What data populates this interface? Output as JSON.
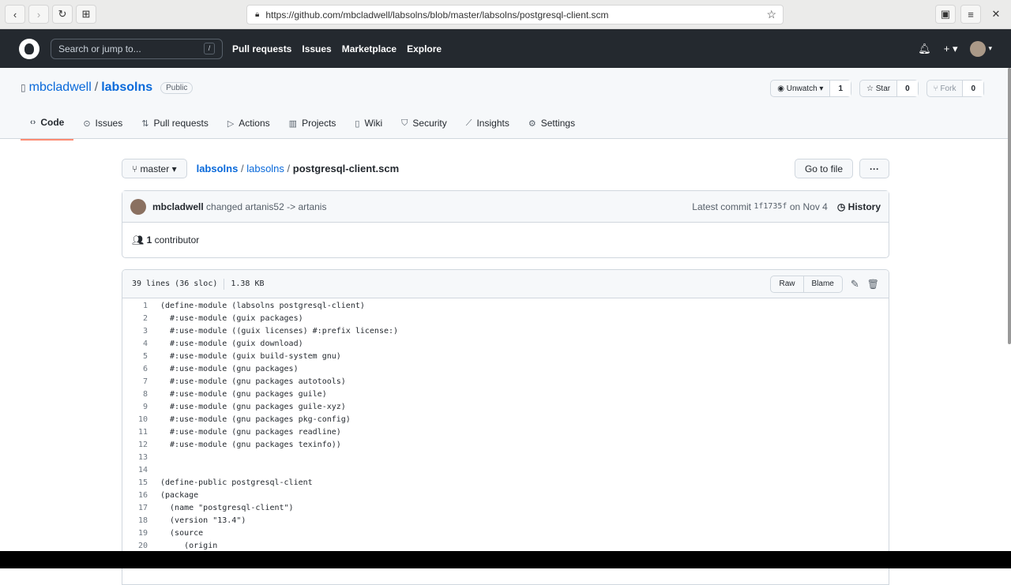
{
  "browser": {
    "url": "https://github.com/mbcladwell/labsolns/blob/master/labsolns/postgresql-client.scm"
  },
  "header": {
    "search_placeholder": "Search or jump to...",
    "slash": "/",
    "nav": [
      "Pull requests",
      "Issues",
      "Marketplace",
      "Explore"
    ]
  },
  "repo": {
    "owner": "mbcladwell",
    "sep": "/",
    "name": "labsolns",
    "visibility": "Public",
    "unwatch": "Unwatch",
    "watch_count": "1",
    "star": "Star",
    "star_count": "0",
    "fork": "Fork",
    "fork_count": "0"
  },
  "tabs": [
    {
      "icon": "‹›",
      "label": "Code"
    },
    {
      "icon": "⊙",
      "label": "Issues"
    },
    {
      "icon": "⇅",
      "label": "Pull requests"
    },
    {
      "icon": "▷",
      "label": "Actions"
    },
    {
      "icon": "▥",
      "label": "Projects"
    },
    {
      "icon": "▯",
      "label": "Wiki"
    },
    {
      "icon": "⛉",
      "label": "Security"
    },
    {
      "icon": "⟋",
      "label": "Insights"
    },
    {
      "icon": "⚙",
      "label": "Settings"
    }
  ],
  "breadcrumb": {
    "branch": "master",
    "root": "labsolns",
    "dir": "labsolns",
    "file": "postgresql-client.scm",
    "goto": "Go to file",
    "more": "···"
  },
  "commit": {
    "author": "mbcladwell",
    "message": "changed artanis52 -> artanis",
    "latest": "Latest commit",
    "sha": "1f1735f",
    "date": "on Nov 4",
    "history": "History"
  },
  "contributors": {
    "count": "1",
    "label": "contributor"
  },
  "file": {
    "lines_info": "39 lines (36 sloc)",
    "size": "1.38 KB",
    "raw": "Raw",
    "blame": "Blame",
    "lines": [
      "(define-module (labsolns postgresql-client)",
      "  #:use-module (guix packages)",
      "  #:use-module ((guix licenses) #:prefix license:)",
      "  #:use-module (guix download)",
      "  #:use-module (guix build-system gnu)",
      "  #:use-module (gnu packages)",
      "  #:use-module (gnu packages autotools)",
      "  #:use-module (gnu packages guile)",
      "  #:use-module (gnu packages guile-xyz)",
      "  #:use-module (gnu packages pkg-config)",
      "  #:use-module (gnu packages readline)",
      "  #:use-module (gnu packages texinfo))",
      "",
      "",
      "(define-public postgresql-client",
      "(package",
      "  (name \"postgresql-client\")",
      "  (version \"13.4\")",
      "  (source",
      "     (origin"
    ]
  }
}
